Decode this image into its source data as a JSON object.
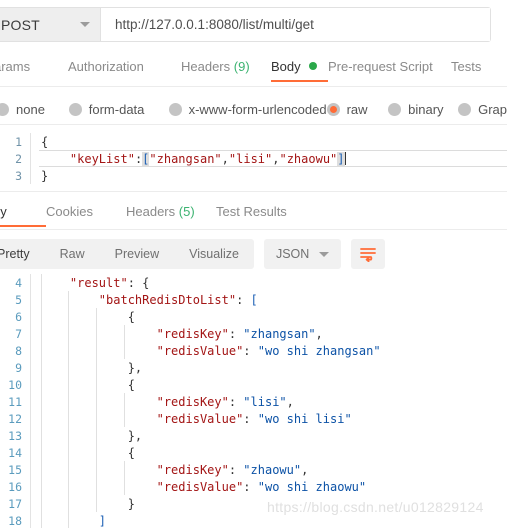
{
  "request": {
    "method": "POST",
    "method_caret": "chevron-down-icon",
    "url": "http://127.0.0.1:8080/list/multi/get",
    "tabs": [
      {
        "label": "arams",
        "active": false,
        "count": null,
        "dot": false
      },
      {
        "label": "Authorization",
        "active": false,
        "count": null,
        "dot": false
      },
      {
        "label": "Headers",
        "active": false,
        "count": "(9)",
        "dot": false
      },
      {
        "label": "Body",
        "active": true,
        "count": null,
        "dot": true
      },
      {
        "label": "Pre-request Script",
        "active": false,
        "count": null,
        "dot": false
      },
      {
        "label": "Tests",
        "active": false,
        "count": null,
        "dot": false
      }
    ],
    "body_types": [
      {
        "label": "none",
        "selected": false
      },
      {
        "label": "form-data",
        "selected": false
      },
      {
        "label": "x-www-form-urlencoded",
        "selected": false
      },
      {
        "label": "raw",
        "selected": true
      },
      {
        "label": "binary",
        "selected": false
      },
      {
        "label": "Grap",
        "selected": false
      }
    ],
    "body_lines": [
      {
        "num": "1",
        "text": "{"
      },
      {
        "num": "2",
        "text": "    \"keyList\":[\"zhangsan\",\"lisi\",\"zhaowu\"]"
      },
      {
        "num": "3",
        "text": "}"
      }
    ]
  },
  "response": {
    "tabs": [
      {
        "label": "dy",
        "active": true,
        "count": null
      },
      {
        "label": "Cookies",
        "active": false,
        "count": null
      },
      {
        "label": "Headers",
        "active": false,
        "count": "(5)"
      },
      {
        "label": "Test Results",
        "active": false,
        "count": null
      }
    ],
    "views": [
      {
        "label": "Pretty",
        "active": true
      },
      {
        "label": "Raw",
        "active": false
      },
      {
        "label": "Preview",
        "active": false
      },
      {
        "label": "Visualize",
        "active": false
      }
    ],
    "format": "JSON",
    "format_caret": "chevron-down-icon",
    "wrap_icon": "word-wrap-icon",
    "body_lines": [
      {
        "num": "4",
        "text": "    \"result\": {"
      },
      {
        "num": "5",
        "text": "        \"batchRedisDtoList\": ["
      },
      {
        "num": "6",
        "text": "            {"
      },
      {
        "num": "7",
        "text": "                \"redisKey\": \"zhangsan\","
      },
      {
        "num": "8",
        "text": "                \"redisValue\": \"wo shi zhangsan\""
      },
      {
        "num": "9",
        "text": "            },"
      },
      {
        "num": "10",
        "text": "            {"
      },
      {
        "num": "11",
        "text": "                \"redisKey\": \"lisi\","
      },
      {
        "num": "12",
        "text": "                \"redisValue\": \"wo shi lisi\""
      },
      {
        "num": "13",
        "text": "            },"
      },
      {
        "num": "14",
        "text": "            {"
      },
      {
        "num": "15",
        "text": "                \"redisKey\": \"zhaowu\","
      },
      {
        "num": "16",
        "text": "                \"redisValue\": \"wo shi zhaowu\""
      },
      {
        "num": "17",
        "text": "            }"
      },
      {
        "num": "18",
        "text": "        ]"
      }
    ]
  },
  "watermark": "https://blog.csdn.net/u012829124",
  "colors": {
    "accent_orange": "#ff6c37",
    "status_green": "#2aa84a",
    "count_green": "#3cb371",
    "json_key": "#a31515",
    "json_string": "#0c52a6",
    "line_number": "#5a9bbd"
  }
}
